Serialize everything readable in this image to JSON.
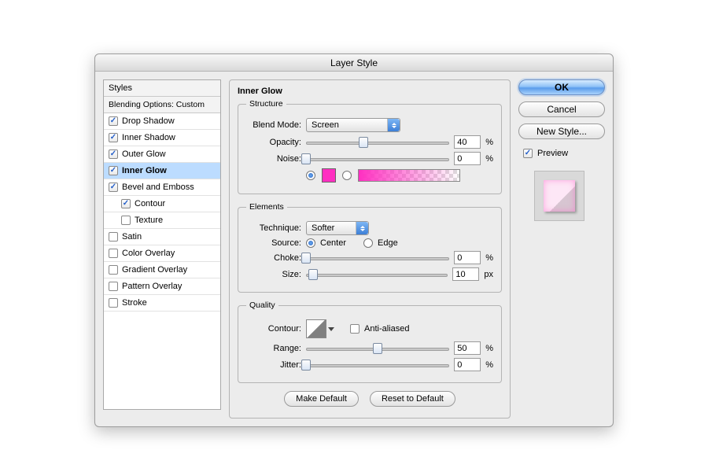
{
  "window": {
    "title": "Layer Style"
  },
  "sidebar": {
    "styles_header": "Styles",
    "blend_header": "Blending Options: Custom",
    "items": [
      {
        "label": "Drop Shadow",
        "checked": true
      },
      {
        "label": "Inner Shadow",
        "checked": true
      },
      {
        "label": "Outer Glow",
        "checked": true
      },
      {
        "label": "Inner Glow",
        "checked": true,
        "selected": true
      },
      {
        "label": "Bevel and Emboss",
        "checked": true
      },
      {
        "label": "Contour",
        "checked": true,
        "indent": true
      },
      {
        "label": "Texture",
        "checked": false,
        "indent": true
      },
      {
        "label": "Satin",
        "checked": false
      },
      {
        "label": "Color Overlay",
        "checked": false
      },
      {
        "label": "Gradient Overlay",
        "checked": false
      },
      {
        "label": "Pattern Overlay",
        "checked": false
      },
      {
        "label": "Stroke",
        "checked": false
      }
    ]
  },
  "panel": {
    "title": "Inner Glow",
    "structure": {
      "legend": "Structure",
      "blend_mode_label": "Blend Mode:",
      "blend_mode_value": "Screen",
      "opacity_label": "Opacity:",
      "opacity_value": "40",
      "opacity_unit": "%",
      "noise_label": "Noise:",
      "noise_value": "0",
      "noise_unit": "%",
      "color_selected": true,
      "swatch_color": "#ff2fc1"
    },
    "elements": {
      "legend": "Elements",
      "technique_label": "Technique:",
      "technique_value": "Softer",
      "source_label": "Source:",
      "source_center": "Center",
      "source_edge": "Edge",
      "source_value": "center",
      "choke_label": "Choke:",
      "choke_value": "0",
      "choke_unit": "%",
      "size_label": "Size:",
      "size_value": "10",
      "size_unit": "px"
    },
    "quality": {
      "legend": "Quality",
      "contour_label": "Contour:",
      "aa_label": "Anti-aliased",
      "aa_checked": false,
      "range_label": "Range:",
      "range_value": "50",
      "range_unit": "%",
      "jitter_label": "Jitter:",
      "jitter_value": "0",
      "jitter_unit": "%"
    },
    "make_default": "Make Default",
    "reset_default": "Reset to Default"
  },
  "right": {
    "ok": "OK",
    "cancel": "Cancel",
    "new_style": "New Style...",
    "preview_label": "Preview",
    "preview_checked": true
  }
}
